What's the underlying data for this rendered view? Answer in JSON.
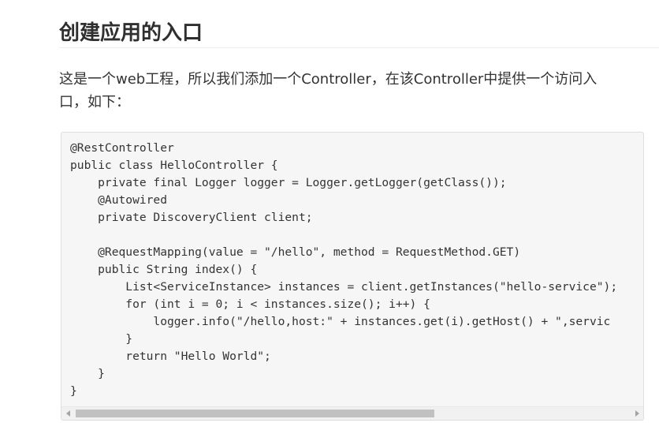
{
  "article": {
    "heading": "创建应用的入口",
    "paragraph_line1": "这是一个web工程，所以我们添加一个Controller，在该Controller中提供一个访问入",
    "paragraph_line2": "口，如下："
  },
  "code_block": {
    "language": "java",
    "lines": [
      "@RestController",
      "public class HelloController {",
      "    private final Logger logger = Logger.getLogger(getClass());",
      "    @Autowired",
      "    private DiscoveryClient client;",
      "",
      "    @RequestMapping(value = \"/hello\", method = RequestMethod.GET)",
      "    public String index() {",
      "        List<ServiceInstance> instances = client.getInstances(\"hello-service\");",
      "        for (int i = 0; i < instances.size(); i++) {",
      "            logger.info(\"/hello,host:\" + instances.get(i).getHost() + \",servic",
      "        }",
      "        return \"Hello World\";",
      "    }",
      "}"
    ]
  },
  "scrollbar": {
    "left_arrow_icon": "triangle-left-icon",
    "right_arrow_icon": "triangle-right-icon",
    "colors": {
      "track": "#f1f1f1",
      "thumb": "#c1c1c1",
      "arrow": "#a3a3a3"
    }
  }
}
